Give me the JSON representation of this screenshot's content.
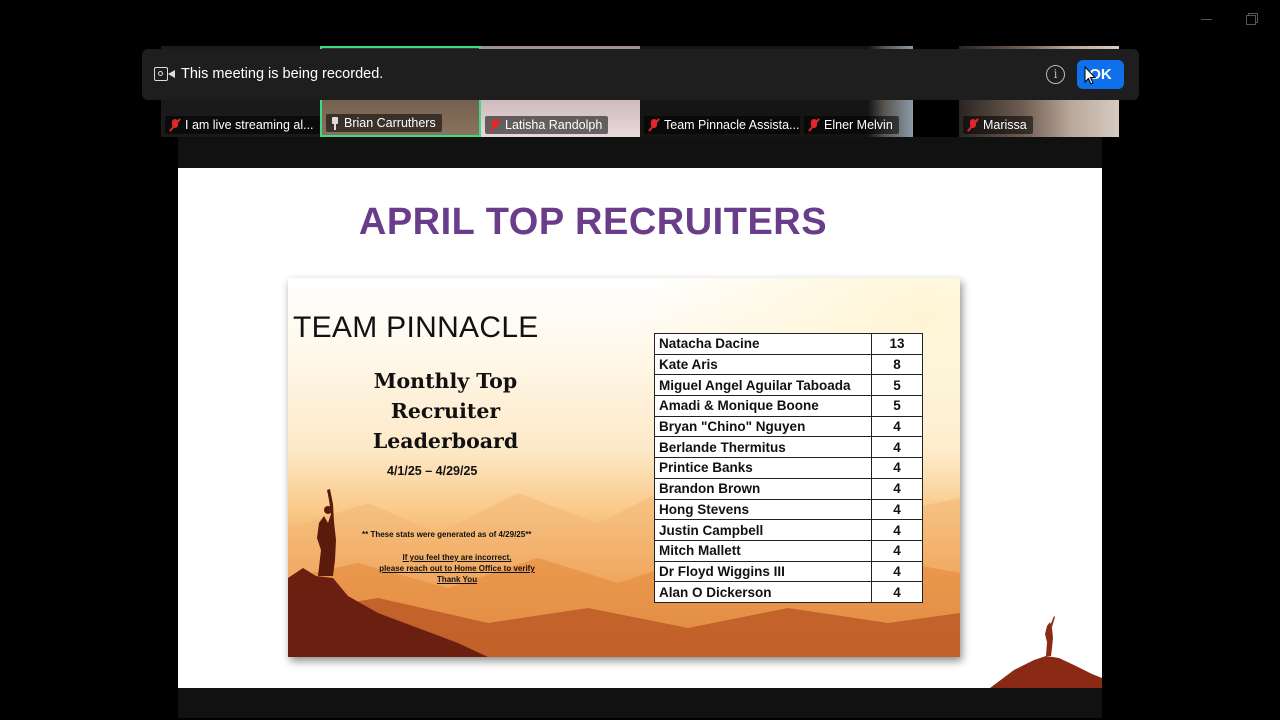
{
  "participants": [
    {
      "name": "I am live streaming al...",
      "muted": true
    },
    {
      "name": "Brian Carruthers",
      "pinned": true
    },
    {
      "name": "Latisha Randolph",
      "muted": true
    },
    {
      "name": "Team Pinnacle Assista...",
      "muted": true
    },
    {
      "name": "Elner Melvin",
      "muted": true
    },
    {
      "name": "Marissa",
      "muted": true
    }
  ],
  "recording_banner": {
    "message": "This meeting is being recorded.",
    "ok_label": "OK",
    "info_icon": "info-icon",
    "accent_color": "#0e71eb"
  },
  "slide": {
    "title": "APRIL TOP RECRUITERS",
    "title_color": "#6a3d8a",
    "poster": {
      "team": "TEAM PINNACLE",
      "heading_line1": "Monthly Top",
      "heading_line2": "Recruiter",
      "heading_line3": "Leaderboard",
      "dates": "4/1/25 – 4/29/25",
      "note": "** These stats were generated as of 4/29/25**",
      "note2_line1": "If you feel they are incorrect,",
      "note2_line2": "please reach out to Home Office to verify",
      "note2_line3": "Thank You"
    },
    "leaderboard": [
      {
        "name": "Natacha Dacine",
        "count": "13"
      },
      {
        "name": "Kate Aris",
        "count": "8"
      },
      {
        "name": "Miguel Angel Aguilar Taboada",
        "count": "5"
      },
      {
        "name": "Amadi & Monique Boone",
        "count": "5"
      },
      {
        "name": "Bryan \"Chino\" Nguyen",
        "count": "4"
      },
      {
        "name": "Berlande Thermitus",
        "count": "4"
      },
      {
        "name": "Printice Banks",
        "count": "4"
      },
      {
        "name": "Brandon Brown",
        "count": "4"
      },
      {
        "name": "Hong Stevens",
        "count": "4"
      },
      {
        "name": "Justin Campbell",
        "count": "4"
      },
      {
        "name": "Mitch Mallett",
        "count": "4"
      },
      {
        "name": "Dr Floyd Wiggins III",
        "count": "4"
      },
      {
        "name": "Alan O Dickerson",
        "count": "4"
      }
    ]
  }
}
